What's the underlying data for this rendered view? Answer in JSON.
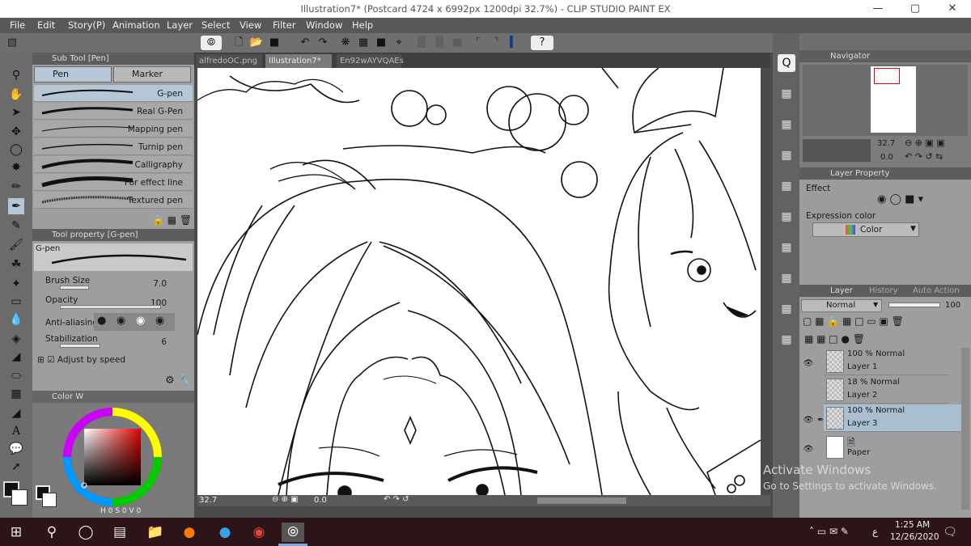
{
  "window": {
    "title": "Illustration7* (Postcard 4724 x 6992px 1200dpi 32.7%) - CLIP STUDIO PAINT EX"
  },
  "menu": [
    "File",
    "Edit",
    "Story(P)",
    "Animation",
    "Layer",
    "Select",
    "View",
    "Filter",
    "Window",
    "Help"
  ],
  "doc_tabs": [
    {
      "label": "alfredoOC.png",
      "active": false
    },
    {
      "label": "Illustration7*",
      "active": true
    },
    {
      "label": "En92wAYVQAEs",
      "active": false
    }
  ],
  "subtool": {
    "title": "Sub Tool [Pen]",
    "tabs": [
      "Pen",
      "Marker"
    ],
    "brushes": [
      "G-pen",
      "Real G-Pen",
      "Mapping pen",
      "Turnip pen",
      "Calligraphy",
      "For effect line",
      "Textured pen"
    ]
  },
  "toolprop": {
    "title": "Tool property [G-pen]",
    "brush_name": "G-pen",
    "brush_size_label": "Brush Size",
    "brush_size_value": "7.0",
    "opacity_label": "Opacity",
    "opacity_value": "100",
    "antialias_label": "Anti-aliasing",
    "stabilization_label": "Stabilization",
    "stabilization_value": "6",
    "adjust_label": "Adjust by speed"
  },
  "colorpanel": {
    "title": "Color W",
    "readout_h": "H",
    "readout_h_val": "0",
    "readout_s": "S",
    "readout_s_val": "0",
    "readout_v": "V",
    "readout_v_val": "0"
  },
  "status": {
    "zoom": "32.7",
    "angle": "0.0"
  },
  "navigator": {
    "title": "Navigator",
    "zoom": "32.7",
    "angle": "0.0"
  },
  "layerprop": {
    "title": "Layer Property",
    "effect_label": "Effect",
    "expression_label": "Expression color",
    "expression_value": "Color"
  },
  "layerpanel": {
    "tabs": [
      "Layer",
      "History",
      "Auto Action"
    ],
    "blend_mode": "Normal",
    "opacity": "100",
    "layers": [
      {
        "mode": "100 % Normal",
        "name": "Layer 1",
        "visible": true,
        "selected": false
      },
      {
        "mode": "18 % Normal",
        "name": "Layer 2",
        "visible": false,
        "selected": false
      },
      {
        "mode": "100 % Normal",
        "name": "Layer 3",
        "visible": true,
        "selected": true
      },
      {
        "mode": "",
        "name": "Paper",
        "visible": true,
        "selected": false
      }
    ]
  },
  "watermark": {
    "line1": "Activate Windows",
    "line2": "Go to Settings to activate Windows."
  },
  "taskbar": {
    "time": "1:25 AM",
    "date": "12/26/2020",
    "lang": "ع"
  },
  "colors": {
    "accent": "#b5c7d6",
    "panel": "#9e9e9e",
    "dark": "#585858"
  }
}
